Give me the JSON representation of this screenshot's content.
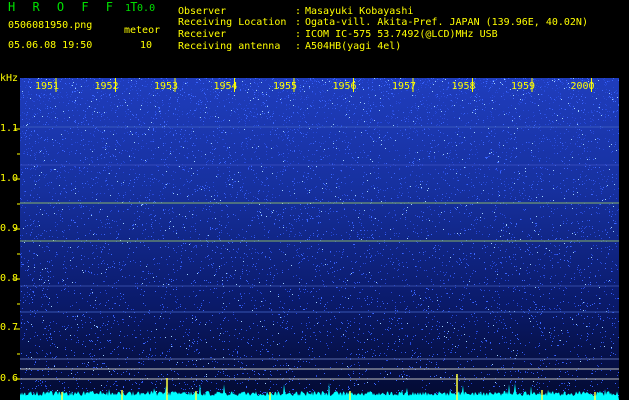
{
  "header": {
    "app_title": "H R O F F T",
    "version": "1.0.0",
    "filename": "0506081950.png",
    "datetime": "05.06.08 19:50",
    "meteor_label": "meteor",
    "meteor_count": "10"
  },
  "info": [
    {
      "label": "Observer",
      "colon": ":",
      "value": "Masayuki Kobayashi"
    },
    {
      "label": "Receiving Location",
      "colon": ":",
      "value": "Ogata-vill. Akita-Pref. JAPAN (139.96E, 40.02N)"
    },
    {
      "label": "Receiver",
      "colon": ":",
      "value": "ICOM IC-575 53.7492(@LCD)MHz USB"
    },
    {
      "label": "Receiving antenna",
      "colon": ":",
      "value": "A504HB(yagi 4el)"
    }
  ],
  "axis": {
    "unit": "kHz",
    "y_ticks": [
      "1.1",
      "1.0",
      "0.9",
      "0.8",
      "0.7",
      "0.6"
    ],
    "time_labels": [
      "1951",
      "1952",
      "1953",
      "1954",
      "1955",
      "1956",
      "1957",
      "1958",
      "1959",
      "2000"
    ]
  },
  "colors": {
    "label": "#ffff00",
    "title": "#00e000",
    "waterfall_base": "#000080",
    "noise": "#1a3cff",
    "baseline": "#00ffff"
  }
}
